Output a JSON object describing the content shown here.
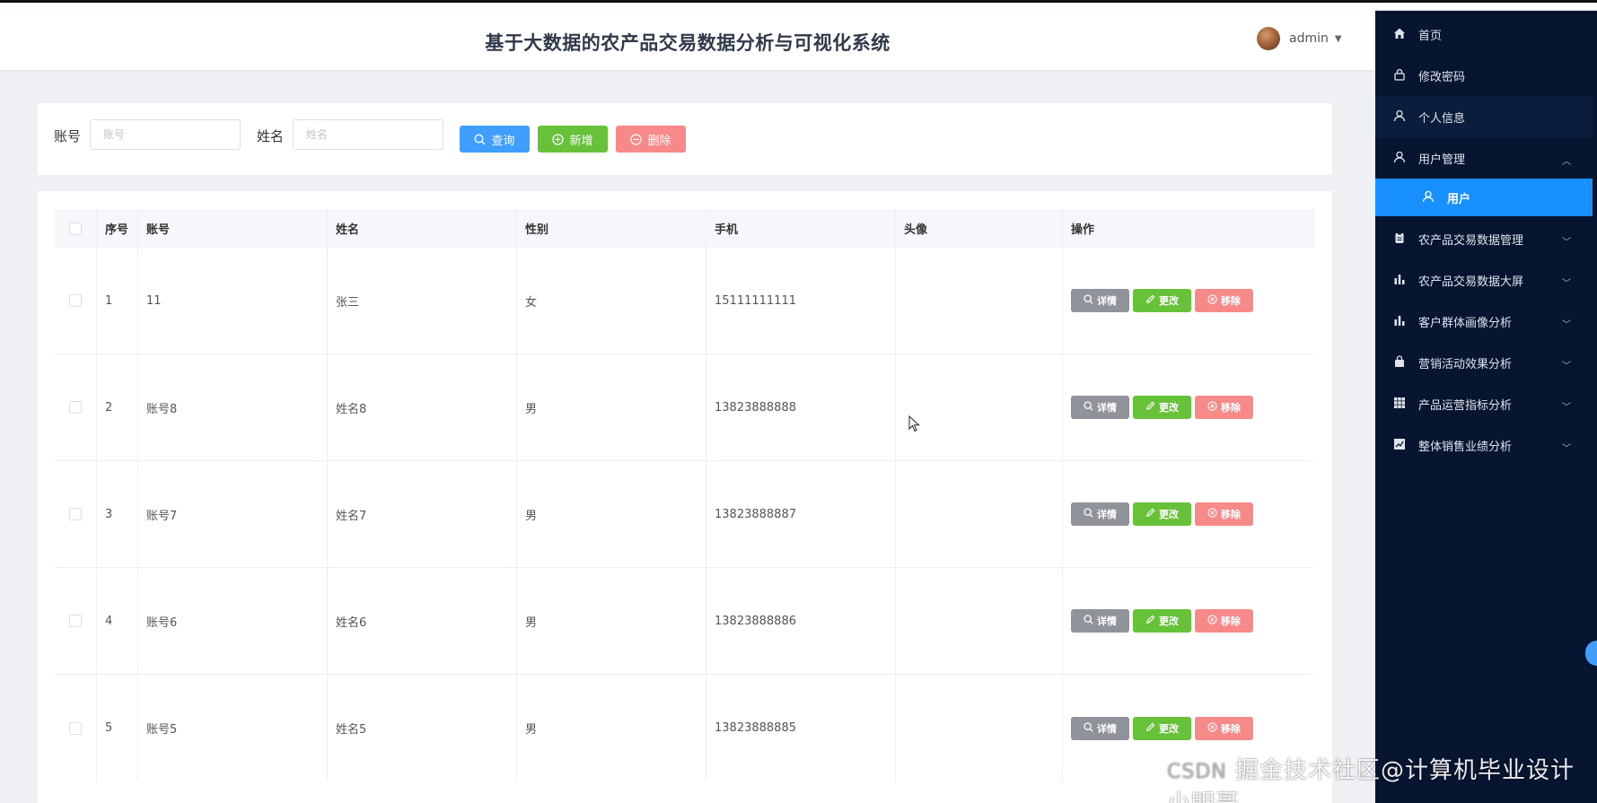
{
  "header": {
    "title": "基于大数据的农产品交易数据分析与可视化系统",
    "username": "admin"
  },
  "search": {
    "account_label": "账号",
    "account_placeholder": "账号",
    "name_label": "姓名",
    "name_placeholder": "姓名",
    "query_label": "查询",
    "add_label": "新增",
    "delete_label": "删除"
  },
  "table": {
    "columns": [
      "序号",
      "账号",
      "姓名",
      "性别",
      "手机",
      "头像",
      "操作"
    ],
    "rows": [
      {
        "index": "1",
        "account": "11",
        "name": "张三",
        "gender": "女",
        "phone": "15111111111"
      },
      {
        "index": "2",
        "account": "账号8",
        "name": "姓名8",
        "gender": "男",
        "phone": "13823888888"
      },
      {
        "index": "3",
        "account": "账号7",
        "name": "姓名7",
        "gender": "男",
        "phone": "13823888887"
      },
      {
        "index": "4",
        "account": "账号6",
        "name": "姓名6",
        "gender": "男",
        "phone": "13823888886"
      },
      {
        "index": "5",
        "account": "账号5",
        "name": "姓名5",
        "gender": "男",
        "phone": "13823888885"
      }
    ],
    "actions": {
      "detail": "详情",
      "edit": "更改",
      "remove": "移除"
    }
  },
  "sidebar": {
    "items": [
      {
        "label": "首页",
        "icon": "home-icon"
      },
      {
        "label": "修改密码",
        "icon": "lock-icon"
      },
      {
        "label": "个人信息",
        "icon": "user-icon"
      },
      {
        "label": "用户管理",
        "icon": "user-icon"
      },
      {
        "label": "用户",
        "icon": "user-icon"
      },
      {
        "label": "农产品交易数据管理",
        "icon": "clipboard-icon"
      },
      {
        "label": "农产品交易数据大屏",
        "icon": "bar-chart-icon"
      },
      {
        "label": "客户群体画像分析",
        "icon": "bar-chart-icon"
      },
      {
        "label": "营销活动效果分析",
        "icon": "bag-icon"
      },
      {
        "label": "产品运营指标分析",
        "icon": "grid-icon"
      },
      {
        "label": "整体销售业绩分析",
        "icon": "trend-icon"
      }
    ]
  },
  "watermark": {
    "text": "掘金技术社区@计算机毕业设计小明哥",
    "prefix": "CSDN"
  },
  "colors": {
    "primary": "#409eff",
    "success": "#67c23a",
    "danger": "#f78989",
    "info": "#909399",
    "sidebar_bg": "#071530",
    "sidebar_active": "#1890ff"
  }
}
